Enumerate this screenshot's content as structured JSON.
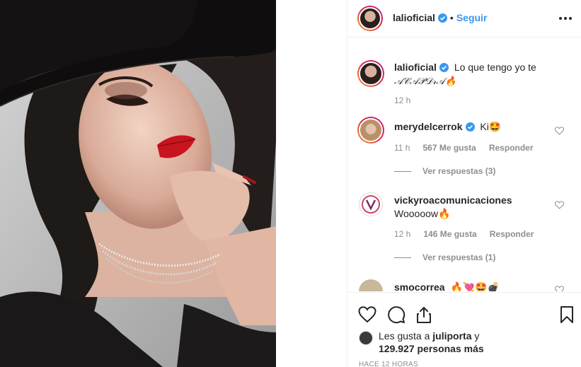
{
  "post": {
    "author": "lalioficial",
    "follow_label": "Seguir",
    "separator": "•",
    "more_icon": "more-horizontal-icon"
  },
  "caption": {
    "username": "lalioficial",
    "text": "Lo que tengo yo te",
    "text_line2": "𝒜𝒞𝒜𝒫𝒟𝓇𝒜🔥",
    "time": "12 h"
  },
  "comments": [
    {
      "username": "merydelcerrok",
      "verified": true,
      "text": "Ki🤩",
      "time": "11 h",
      "likes": "567 Me gusta",
      "reply": "Responder",
      "view_replies": "Ver respuestas (3)"
    },
    {
      "username": "vickyroacomunicaciones",
      "verified": false,
      "text": "Wooooow🔥",
      "time": "12 h",
      "likes": "146 Me gusta",
      "reply": "Responder",
      "view_replies": "Ver respuestas (1)"
    },
    {
      "username": "smocorrea",
      "verified": false,
      "text": "🔥💘🤩💣"
    }
  ],
  "actions": {
    "like_icon": "heart-icon",
    "comment_icon": "comment-icon",
    "share_icon": "share-icon",
    "save_icon": "bookmark-icon"
  },
  "likes": {
    "prefix": "Les gusta a",
    "user": "juliporta",
    "conj": "y",
    "count": "129.927 personas más"
  },
  "posted_ago": "HACE 12 HORAS",
  "colors": {
    "link": "#3897f0",
    "verified": "#3897f0",
    "secondary_text": "#8e8e8e",
    "lipstick": "#c8141e"
  }
}
